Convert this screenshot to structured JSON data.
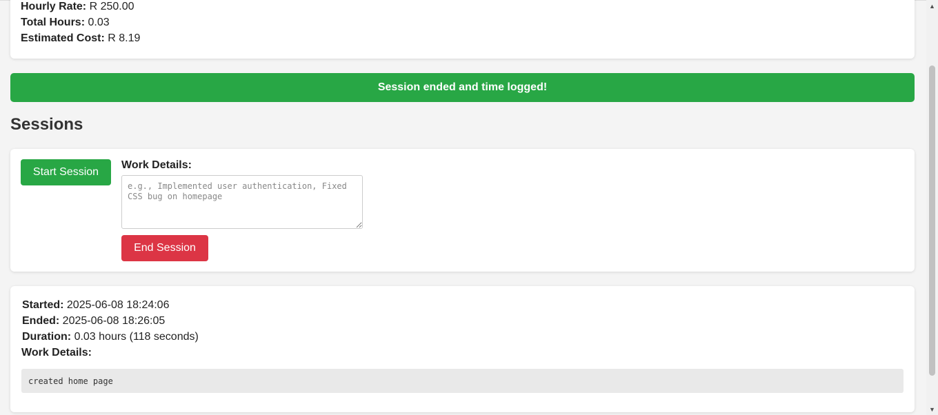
{
  "summary": {
    "hourly_rate_label": "Hourly Rate:",
    "hourly_rate_value": "R 250.00",
    "total_hours_label": "Total Hours:",
    "total_hours_value": "0.03",
    "estimated_cost_label": "Estimated Cost:",
    "estimated_cost_value": "R 8.19"
  },
  "alert": {
    "message": "Session ended and time logged!"
  },
  "sessions": {
    "title": "Sessions",
    "start_button": "Start Session",
    "work_details_label": "Work Details:",
    "work_details_placeholder": "e.g., Implemented user authentication, Fixed CSS bug on homepage",
    "end_button": "End Session"
  },
  "log": {
    "started_label": "Started:",
    "started_value": "2025-06-08 18:24:06",
    "ended_label": "Ended:",
    "ended_value": "2025-06-08 18:26:05",
    "duration_label": "Duration:",
    "duration_value": "0.03 hours (118 seconds)",
    "work_details_label": "Work Details:",
    "work_details_value": "created home page"
  },
  "colors": {
    "success": "#28a745",
    "danger": "#dc3545",
    "background": "#f4f4f4"
  },
  "icons": {
    "scroll_up": "triangle-up-icon",
    "scroll_down": "triangle-down-icon"
  }
}
